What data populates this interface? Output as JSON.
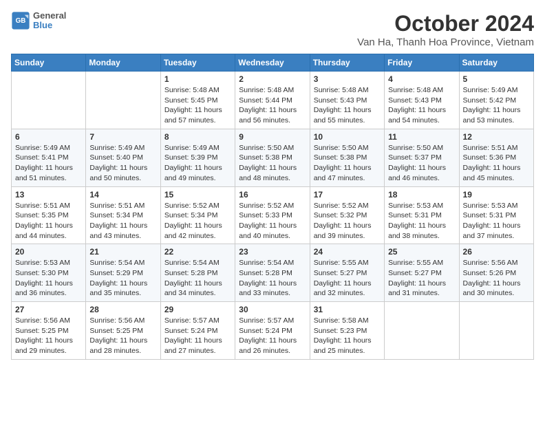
{
  "logo": {
    "line1": "General",
    "line2": "Blue"
  },
  "title": "October 2024",
  "subtitle": "Van Ha, Thanh Hoa Province, Vietnam",
  "weekdays": [
    "Sunday",
    "Monday",
    "Tuesday",
    "Wednesday",
    "Thursday",
    "Friday",
    "Saturday"
  ],
  "weeks": [
    [
      {
        "day": "",
        "detail": ""
      },
      {
        "day": "",
        "detail": ""
      },
      {
        "day": "1",
        "detail": "Sunrise: 5:48 AM\nSunset: 5:45 PM\nDaylight: 11 hours and 57 minutes."
      },
      {
        "day": "2",
        "detail": "Sunrise: 5:48 AM\nSunset: 5:44 PM\nDaylight: 11 hours and 56 minutes."
      },
      {
        "day": "3",
        "detail": "Sunrise: 5:48 AM\nSunset: 5:43 PM\nDaylight: 11 hours and 55 minutes."
      },
      {
        "day": "4",
        "detail": "Sunrise: 5:48 AM\nSunset: 5:43 PM\nDaylight: 11 hours and 54 minutes."
      },
      {
        "day": "5",
        "detail": "Sunrise: 5:49 AM\nSunset: 5:42 PM\nDaylight: 11 hours and 53 minutes."
      }
    ],
    [
      {
        "day": "6",
        "detail": "Sunrise: 5:49 AM\nSunset: 5:41 PM\nDaylight: 11 hours and 51 minutes."
      },
      {
        "day": "7",
        "detail": "Sunrise: 5:49 AM\nSunset: 5:40 PM\nDaylight: 11 hours and 50 minutes."
      },
      {
        "day": "8",
        "detail": "Sunrise: 5:49 AM\nSunset: 5:39 PM\nDaylight: 11 hours and 49 minutes."
      },
      {
        "day": "9",
        "detail": "Sunrise: 5:50 AM\nSunset: 5:38 PM\nDaylight: 11 hours and 48 minutes."
      },
      {
        "day": "10",
        "detail": "Sunrise: 5:50 AM\nSunset: 5:38 PM\nDaylight: 11 hours and 47 minutes."
      },
      {
        "day": "11",
        "detail": "Sunrise: 5:50 AM\nSunset: 5:37 PM\nDaylight: 11 hours and 46 minutes."
      },
      {
        "day": "12",
        "detail": "Sunrise: 5:51 AM\nSunset: 5:36 PM\nDaylight: 11 hours and 45 minutes."
      }
    ],
    [
      {
        "day": "13",
        "detail": "Sunrise: 5:51 AM\nSunset: 5:35 PM\nDaylight: 11 hours and 44 minutes."
      },
      {
        "day": "14",
        "detail": "Sunrise: 5:51 AM\nSunset: 5:34 PM\nDaylight: 11 hours and 43 minutes."
      },
      {
        "day": "15",
        "detail": "Sunrise: 5:52 AM\nSunset: 5:34 PM\nDaylight: 11 hours and 42 minutes."
      },
      {
        "day": "16",
        "detail": "Sunrise: 5:52 AM\nSunset: 5:33 PM\nDaylight: 11 hours and 40 minutes."
      },
      {
        "day": "17",
        "detail": "Sunrise: 5:52 AM\nSunset: 5:32 PM\nDaylight: 11 hours and 39 minutes."
      },
      {
        "day": "18",
        "detail": "Sunrise: 5:53 AM\nSunset: 5:31 PM\nDaylight: 11 hours and 38 minutes."
      },
      {
        "day": "19",
        "detail": "Sunrise: 5:53 AM\nSunset: 5:31 PM\nDaylight: 11 hours and 37 minutes."
      }
    ],
    [
      {
        "day": "20",
        "detail": "Sunrise: 5:53 AM\nSunset: 5:30 PM\nDaylight: 11 hours and 36 minutes."
      },
      {
        "day": "21",
        "detail": "Sunrise: 5:54 AM\nSunset: 5:29 PM\nDaylight: 11 hours and 35 minutes."
      },
      {
        "day": "22",
        "detail": "Sunrise: 5:54 AM\nSunset: 5:28 PM\nDaylight: 11 hours and 34 minutes."
      },
      {
        "day": "23",
        "detail": "Sunrise: 5:54 AM\nSunset: 5:28 PM\nDaylight: 11 hours and 33 minutes."
      },
      {
        "day": "24",
        "detail": "Sunrise: 5:55 AM\nSunset: 5:27 PM\nDaylight: 11 hours and 32 minutes."
      },
      {
        "day": "25",
        "detail": "Sunrise: 5:55 AM\nSunset: 5:27 PM\nDaylight: 11 hours and 31 minutes."
      },
      {
        "day": "26",
        "detail": "Sunrise: 5:56 AM\nSunset: 5:26 PM\nDaylight: 11 hours and 30 minutes."
      }
    ],
    [
      {
        "day": "27",
        "detail": "Sunrise: 5:56 AM\nSunset: 5:25 PM\nDaylight: 11 hours and 29 minutes."
      },
      {
        "day": "28",
        "detail": "Sunrise: 5:56 AM\nSunset: 5:25 PM\nDaylight: 11 hours and 28 minutes."
      },
      {
        "day": "29",
        "detail": "Sunrise: 5:57 AM\nSunset: 5:24 PM\nDaylight: 11 hours and 27 minutes."
      },
      {
        "day": "30",
        "detail": "Sunrise: 5:57 AM\nSunset: 5:24 PM\nDaylight: 11 hours and 26 minutes."
      },
      {
        "day": "31",
        "detail": "Sunrise: 5:58 AM\nSunset: 5:23 PM\nDaylight: 11 hours and 25 minutes."
      },
      {
        "day": "",
        "detail": ""
      },
      {
        "day": "",
        "detail": ""
      }
    ]
  ]
}
